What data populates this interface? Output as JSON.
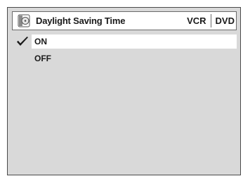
{
  "title_bar": {
    "title": "Daylight Saving Time",
    "icon": "disc-icon",
    "modes": [
      "VCR",
      "DVD"
    ]
  },
  "options": [
    {
      "label": "ON",
      "selected": true,
      "icon": "checkmark-icon"
    },
    {
      "label": "OFF",
      "selected": false
    }
  ],
  "colors": {
    "background": "#d9d9d9",
    "panel": "#ffffff",
    "text": "#1a1a1a",
    "border": "#6a6a6a"
  }
}
